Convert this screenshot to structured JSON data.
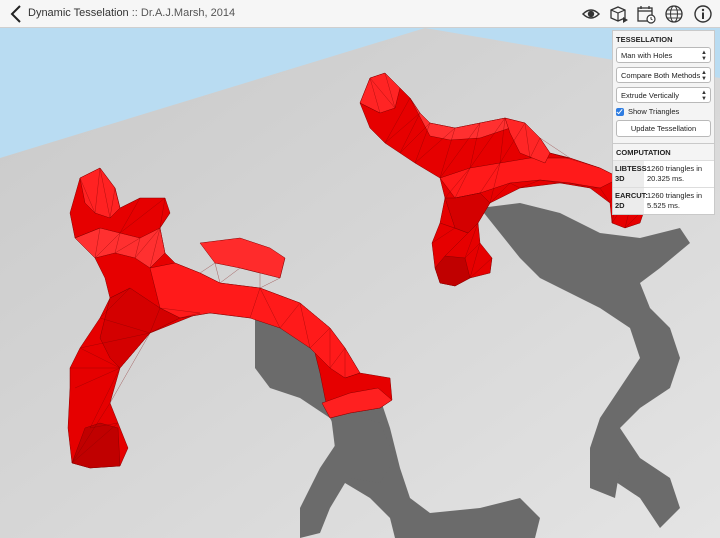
{
  "window": {
    "title": "Dynamic Tesselation",
    "subtitle": ":: Dr.A.J.Marsh, 2014"
  },
  "toolbar": {
    "icons": [
      "eye-icon",
      "cube-icon",
      "calendar-clock-icon",
      "globe-icon",
      "info-icon"
    ]
  },
  "tessellation": {
    "heading": "TESSELLATION",
    "shape_select": "Man with Holes",
    "method_select": "Compare Both Methods",
    "extrude_select": "Extrude Vertically",
    "show_triangles_label": "Show Triangles",
    "show_triangles_checked": true,
    "update_button": "Update Tessellation"
  },
  "computation": {
    "heading": "COMPUTATION",
    "rows": [
      {
        "label": "LIBTESS: 3D",
        "value": "1260 triangles in 20.325 ms."
      },
      {
        "label": "EARCUT: 2D",
        "value": "1260 triangles in 5.525 ms."
      }
    ]
  },
  "colors": {
    "sky": "#b9dcf2",
    "ground": "#cfcfcf",
    "shadow": "#6b6b6b",
    "model": "#ff1a1a",
    "accent": "#2f7de1"
  }
}
